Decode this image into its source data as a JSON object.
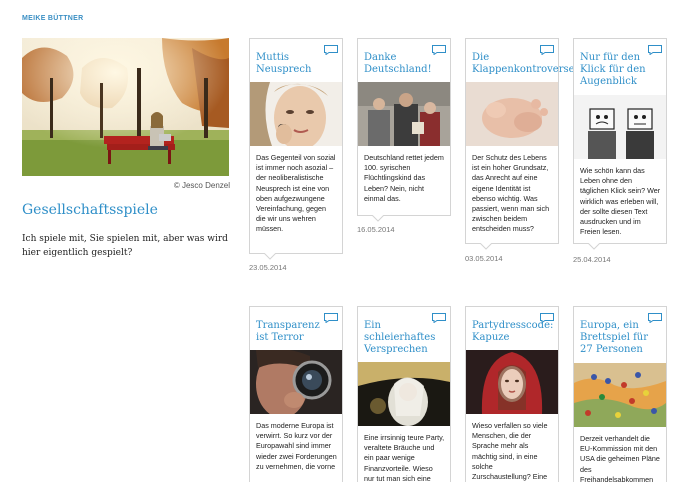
{
  "author": "MEIKE BÜTTNER",
  "hero": {
    "credit": "© Jesco Denzel"
  },
  "blog": {
    "title": "Gesellschaftsspiele",
    "description": "Ich spiele mit, Sie spielen mit, aber was wird hier eigentlich gespielt?"
  },
  "posts": [
    {
      "title": "Muttis Neusprech",
      "text": "Das Gegenteil von sozial ist immer noch asozial – der neoliberalistische Neusprech ist eine von oben aufgezwungene Vereinfachung, gegen die wir uns wehren müssen.",
      "date": "23.05.2014"
    },
    {
      "title": "Danke Deutschland!",
      "text": "Deutschland rettet jedem 100. syrischen Flüchtlingskind das Leben? Nein, nicht einmal das.",
      "date": "16.05.2014"
    },
    {
      "title": "Die Klappenkontroverse",
      "text": "Der Schutz des Lebens ist ein hoher Grundsatz, das Anrecht auf eine eigene Identität ist ebenso wichtig. Was passiert, wenn man sich zwischen beidem entscheiden muss?",
      "date": "03.05.2014"
    },
    {
      "title": "Nur für den Klick für den Augenblick",
      "text": "Wie schön kann das Leben ohne den täglichen Klick sein? Wer wirklich was erleben will, der sollte diesen Text ausdrucken und im Freien lesen.",
      "date": "25.04.2014"
    },
    {
      "title": "Transparenz ist Terror",
      "text": "Das moderne Europa ist verwirrt. So kurz vor der Europawahl sind immer wieder zwei Forderungen zu vernehmen, die vorne"
    },
    {
      "title": "Ein schleierhaftes Versprechen",
      "text": "Eine irrsinnig teure Party, veraltete Bräuche und ein paar wenige Finanzvorteile. Wieso nur tut man sich eine"
    },
    {
      "title": "Partydresscode: Kapuze",
      "text": "Wieso verfallen so viele Menschen, die der Sprache mehr als mächtig sind, in eine solche Zurschaustellung? Eine"
    },
    {
      "title": "Europa, ein Brettspiel für 27 Personen",
      "text": "Derzeit verhandelt die EU-Kommission mit den USA die geheimen Pläne des Freihandelsabkommen"
    }
  ],
  "colors": {
    "accent": "#2f8fc8"
  }
}
